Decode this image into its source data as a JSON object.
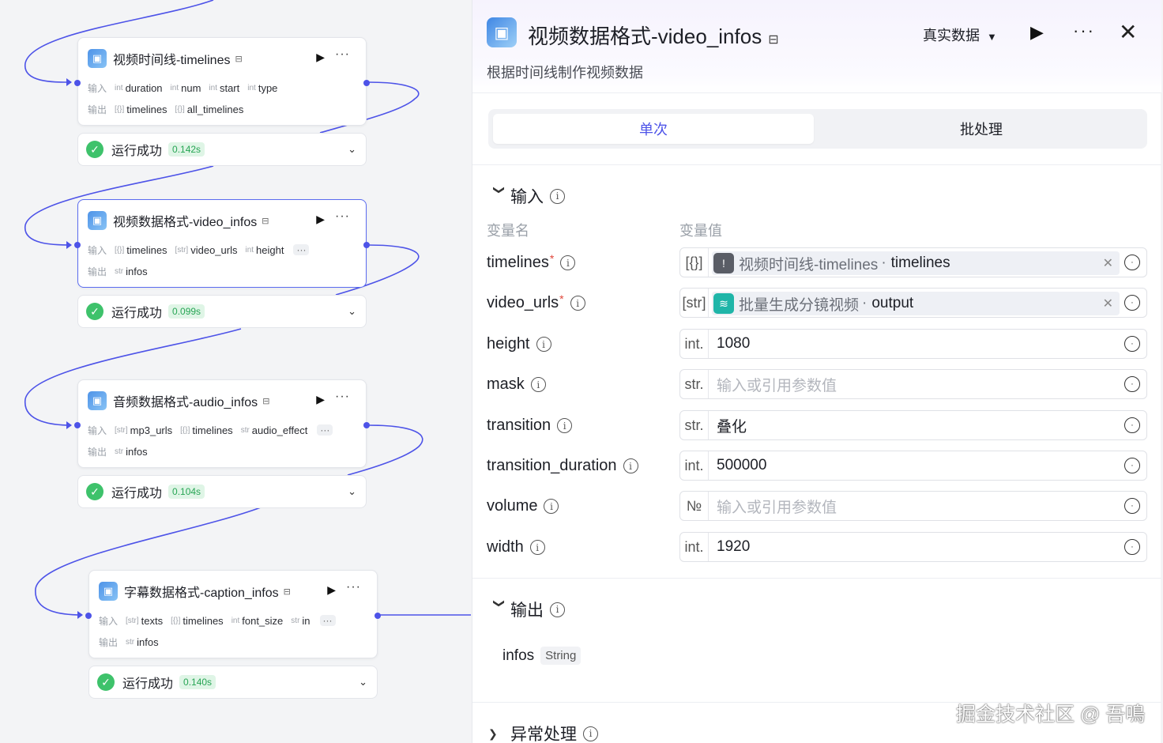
{
  "canvas": {
    "io_labels": {
      "input": "输入",
      "output": "输出"
    },
    "status_text": "运行成功",
    "nodes": [
      {
        "title": "视频时间线-timelines",
        "inputs": [
          {
            "type": "int",
            "name": "duration"
          },
          {
            "type": "int",
            "name": "num"
          },
          {
            "type": "int",
            "name": "start"
          },
          {
            "type": "int",
            "name": "type"
          }
        ],
        "outputs": [
          {
            "type": "[{}]",
            "name": "timelines"
          },
          {
            "type": "[{}]",
            "name": "all_timelines"
          }
        ],
        "time": "0.142s"
      },
      {
        "title": "视频数据格式-video_infos",
        "inputs": [
          {
            "type": "[{}]",
            "name": "timelines"
          },
          {
            "type": "[str]",
            "name": "video_urls"
          },
          {
            "type": "int",
            "name": "height"
          }
        ],
        "outputs": [
          {
            "type": "str",
            "name": "infos"
          }
        ],
        "time": "0.099s"
      },
      {
        "title": "音频数据格式-audio_infos",
        "inputs": [
          {
            "type": "[str]",
            "name": "mp3_urls"
          },
          {
            "type": "[{}]",
            "name": "timelines"
          },
          {
            "type": "str",
            "name": "audio_effect"
          }
        ],
        "outputs": [
          {
            "type": "str",
            "name": "infos"
          }
        ],
        "time": "0.104s"
      },
      {
        "title": "字幕数据格式-caption_infos",
        "inputs": [
          {
            "type": "[str]",
            "name": "texts"
          },
          {
            "type": "[{}]",
            "name": "timelines"
          },
          {
            "type": "int",
            "name": "font_size"
          },
          {
            "type": "str",
            "name": "in"
          }
        ],
        "outputs": [
          {
            "type": "str",
            "name": "infos"
          }
        ],
        "time": "0.140s"
      }
    ]
  },
  "panel": {
    "title": "视频数据格式-video_infos",
    "description": "根据时间线制作视频数据",
    "data_mode": "真实数据",
    "tabs": [
      "单次",
      "批处理"
    ],
    "input_section": "输入",
    "col_name": "变量名",
    "col_value": "变量值",
    "placeholder": "输入或引用参数值",
    "params": [
      {
        "name": "timelines",
        "required": true,
        "type": "[{}]",
        "ref_node": "视频时间线-timelines",
        "ref_field": "timelines",
        "ref_color": "#5a5d66"
      },
      {
        "name": "video_urls",
        "required": true,
        "type": "[str]",
        "ref_node": "批量生成分镜视频",
        "ref_field": "output",
        "ref_color": "#1fb5a8"
      },
      {
        "name": "height",
        "required": false,
        "type": "int.",
        "value": "1080"
      },
      {
        "name": "mask",
        "required": false,
        "type": "str.",
        "value": ""
      },
      {
        "name": "transition",
        "required": false,
        "type": "str.",
        "value": "叠化"
      },
      {
        "name": "transition_duration",
        "required": false,
        "type": "int.",
        "value": "500000"
      },
      {
        "name": "volume",
        "required": false,
        "type": "№",
        "value": ""
      },
      {
        "name": "width",
        "required": false,
        "type": "int.",
        "value": "1920"
      }
    ],
    "output_section": "输出",
    "output": {
      "name": "infos",
      "type": "String"
    },
    "error_section": "异常处理"
  },
  "watermark": "掘金技术社区 @ 吾鳴",
  "colors": {
    "accent": "#4d53e8",
    "success": "#3ec26b",
    "required": "#e0473b"
  }
}
